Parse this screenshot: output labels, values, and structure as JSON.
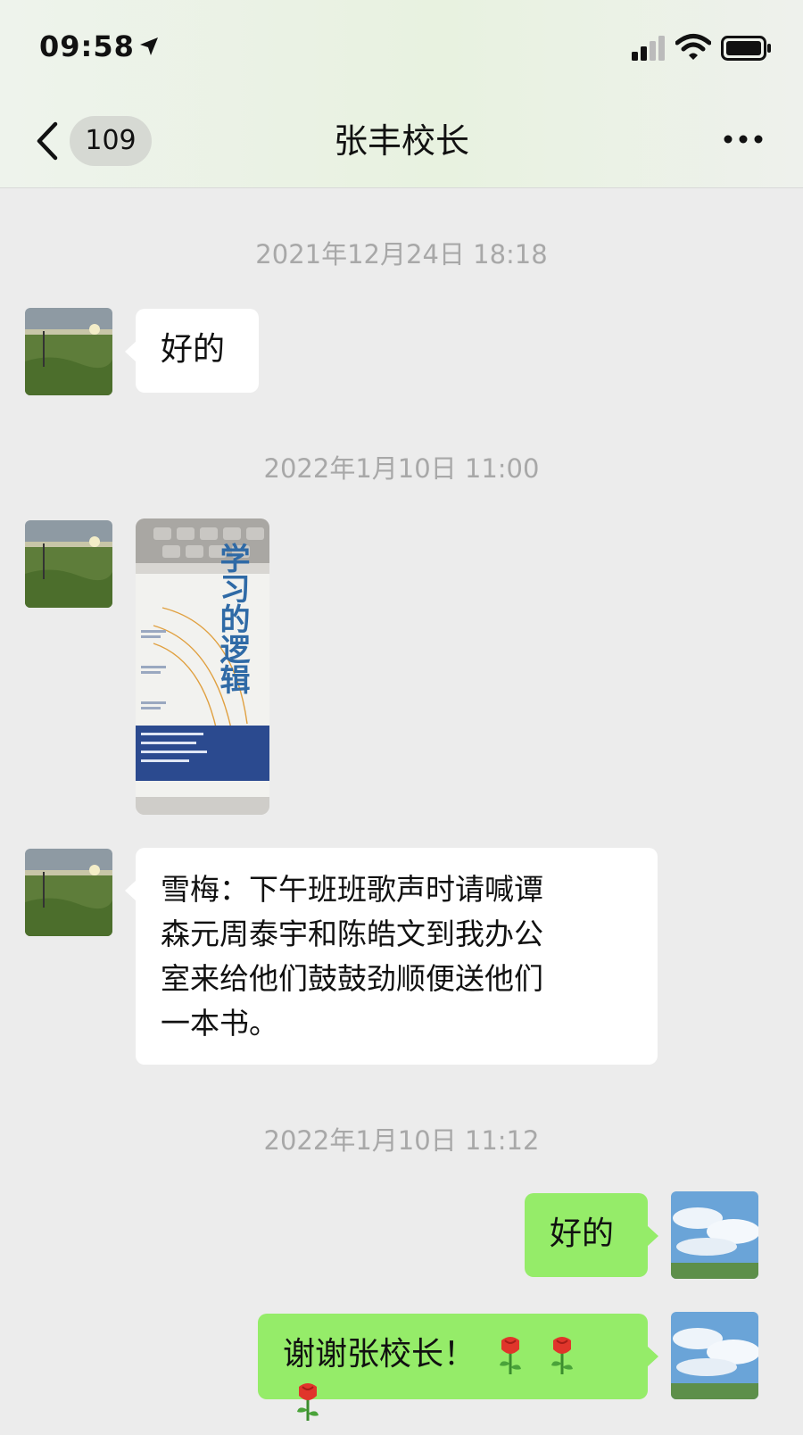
{
  "status_bar": {
    "time": "09:58",
    "icons": [
      "location-arrow-icon",
      "signal-icon",
      "wifi-icon",
      "battery-icon"
    ]
  },
  "nav": {
    "back_icon": "chevron-left-icon",
    "unread_count": "109",
    "title": "张丰校长",
    "more_icon": "more-dots-icon"
  },
  "messages": [
    {
      "type": "timestamp",
      "text": "2021年12月24日 18:18"
    },
    {
      "type": "text",
      "side": "left",
      "text": "好的"
    },
    {
      "type": "timestamp",
      "text": "2022年1月10日 11:00"
    },
    {
      "type": "image",
      "side": "left",
      "book_title": "学习的逻辑"
    },
    {
      "type": "text",
      "side": "left",
      "lines": [
        "雪梅：下午班班歌声时请喊谭",
        "森元周泰宇和陈皓文到我办公",
        "室来给他们鼓鼓劲顺便送他们",
        "一本书。"
      ]
    },
    {
      "type": "timestamp",
      "text": "2022年1月10日 11:12"
    },
    {
      "type": "text",
      "side": "right",
      "text": "好的"
    },
    {
      "type": "text",
      "side": "right",
      "text": "谢谢张校长！",
      "emoji": [
        "rose-icon",
        "rose-icon",
        "rose-icon"
      ]
    }
  ],
  "colors": {
    "chat_background": "#ececec",
    "incoming_bubble": "#ffffff",
    "outgoing_bubble": "#95ec69",
    "timestamp_text": "#a8a8a8"
  }
}
